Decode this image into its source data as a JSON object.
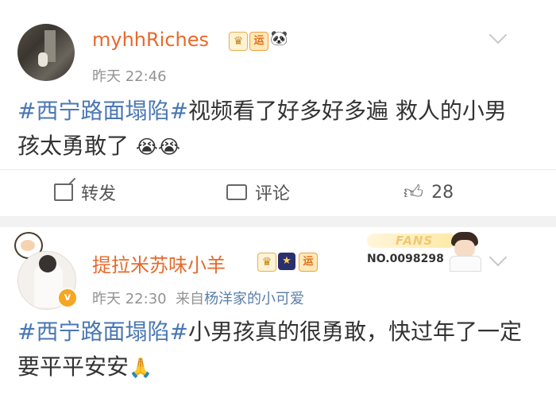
{
  "post1": {
    "username": "myhhRiches",
    "badges": [
      "crown-badge",
      "yun-badge",
      "panda-badge"
    ],
    "time": "昨天 22:46",
    "hashtag": "#西宁路面塌陷#",
    "text": "视频看了好多好多遍 救人的小男孩太勇敢了",
    "emoji": "😭😭",
    "actions": {
      "repost_label": "转发",
      "comment_label": "评论",
      "like_count": "28"
    }
  },
  "post2": {
    "username": "提拉米苏味小羊",
    "badges": [
      "crown-badge",
      "star-badge",
      "yun-badge"
    ],
    "time": "昨天 22:30",
    "source_prefix": "来自",
    "source_name": "杨洋家的小可爱",
    "fans_card": {
      "label": "FANS",
      "number": "NO.0098298"
    },
    "hashtag": "#西宁路面塌陷#",
    "text": "小男孩真的很勇敢，快过年了一定要平平安安",
    "emoji": "🙏"
  },
  "colors": {
    "username": "#e8692b",
    "hashtag": "#4a77b4",
    "meta": "#939393",
    "separator": "#f2f2f2"
  }
}
